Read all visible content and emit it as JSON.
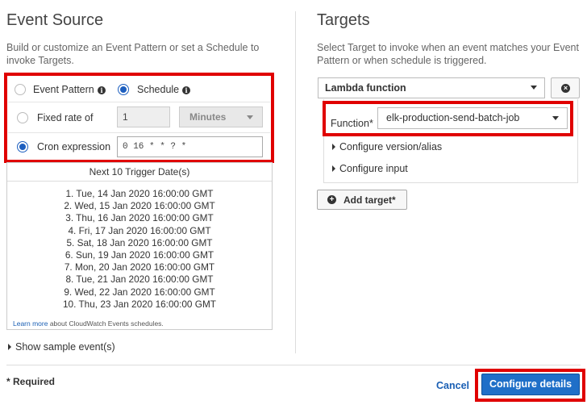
{
  "event_source": {
    "title": "Event Source",
    "description": "Build or customize an Event Pattern or set a Schedule to invoke Targets.",
    "event_pattern_label": "Event Pattern",
    "schedule_label": "Schedule",
    "selected_mode": "Schedule",
    "fixed_rate_label": "Fixed rate of",
    "fixed_rate_value": "1",
    "fixed_rate_unit": "Minutes",
    "cron_label": "Cron expression",
    "cron_value": "0 16 * * ? *",
    "selected_schedule_type": "Cron expression",
    "trigger_header": "Next 10 Trigger Date(s)",
    "trigger_dates": [
      "1. Tue, 14 Jan 2020 16:00:00 GMT",
      "2. Wed, 15 Jan 2020 16:00:00 GMT",
      "3. Thu, 16 Jan 2020 16:00:00 GMT",
      "4. Fri, 17 Jan 2020 16:00:00 GMT",
      "5. Sat, 18 Jan 2020 16:00:00 GMT",
      "6. Sun, 19 Jan 2020 16:00:00 GMT",
      "7. Mon, 20 Jan 2020 16:00:00 GMT",
      "8. Tue, 21 Jan 2020 16:00:00 GMT",
      "9. Wed, 22 Jan 2020 16:00:00 GMT",
      "10. Thu, 23 Jan 2020 16:00:00 GMT"
    ],
    "learn_more_link": "Learn more",
    "learn_more_rest": " about CloudWatch Events schedules.",
    "show_sample": "Show sample event(s)"
  },
  "targets": {
    "title": "Targets",
    "description": "Select Target to invoke when an event matches your Event Pattern or when schedule is triggered.",
    "target_type": "Lambda function",
    "function_label": "Function*",
    "function_value": "elk-production-send-batch-job",
    "configure_version": "Configure version/alias",
    "configure_input": "Configure input",
    "add_target": "Add target*"
  },
  "footer": {
    "required_note": "* Required",
    "cancel": "Cancel",
    "configure_details": "Configure details"
  },
  "colors": {
    "primary": "#1f6fc8",
    "highlight": "#e00000",
    "link": "#1a5fb4"
  }
}
